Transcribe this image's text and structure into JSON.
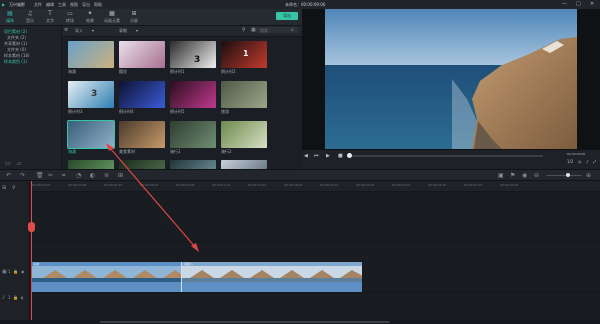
{
  "window": {
    "app_name": "万兴喵影",
    "menus": [
      "文件",
      "编辑",
      "工具",
      "视图",
      "导出",
      "帮助"
    ],
    "project_title": "未命名：00:00:09:06",
    "controls": [
      "—",
      "□",
      "✕"
    ]
  },
  "toolbar": {
    "tabs": [
      {
        "icon": "▤",
        "label": "媒体"
      },
      {
        "icon": "♫",
        "label": "音乐"
      },
      {
        "icon": "T",
        "label": "文字"
      },
      {
        "icon": "▭",
        "label": "转场"
      },
      {
        "icon": "✦",
        "label": "效果"
      },
      {
        "icon": "▦",
        "label": "动画元素"
      },
      {
        "icon": "⊞",
        "label": "分屏"
      }
    ],
    "export_label": "导出"
  },
  "sidebar": {
    "items": [
      {
        "label": "项目素材 (2)",
        "active": true
      },
      {
        "label": "文件夹 (2)",
        "active": false
      },
      {
        "label": "共享素材 (1)",
        "active": false
      },
      {
        "label": "文件夹 (0)",
        "active": false
      },
      {
        "label": "样本素材 (18)",
        "active": false
      },
      {
        "label": "样本颜色 (1)",
        "active": true
      }
    ],
    "bottom_icons": [
      "folder-icon",
      "folder-open-icon"
    ]
  },
  "library": {
    "import_label": "导入",
    "record_label": "录制",
    "search_placeholder": "搜索",
    "items": [
      {
        "label": "海滩",
        "color": "#6aa0c8",
        "color2": "#c9b27e"
      },
      {
        "label": "樱花",
        "color": "#e9e0ec",
        "color2": "#a7708f"
      },
      {
        "label": "倒计时1",
        "color": "#2a2a2a",
        "color2": "#efefef"
      },
      {
        "label": "倒计时2",
        "color": "#1a0e0e",
        "color2": "#c23a2e"
      },
      {
        "label": "倒计时3",
        "color": "#e8eef2",
        "color2": "#2d7fb3"
      },
      {
        "label": "倒计时4",
        "color": "#0d1230",
        "color2": "#3c5bd9"
      },
      {
        "label": "倒计时5",
        "color": "#2b0d1e",
        "color2": "#c03a8e"
      },
      {
        "label": "旅游",
        "color": "#4d5a47",
        "color2": "#9ca68a"
      },
      {
        "label": "海滩",
        "color": "#3a5e7a",
        "color2": "#8fb2c9"
      },
      {
        "label": "美食素材",
        "color": "#4c3b2c",
        "color2": "#c69a6a"
      },
      {
        "label": "骑行1",
        "color": "#2f3d2f",
        "color2": "#6f8e75"
      },
      {
        "label": "骑行2",
        "color": "#6c8a4c",
        "color2": "#d7dfc4"
      },
      {
        "label": "",
        "color": "#2a4a2a",
        "color2": "#6fa86f"
      },
      {
        "label": "",
        "color": "#1c2a1c",
        "color2": "#577a57"
      },
      {
        "label": "",
        "color": "#23343a",
        "color2": "#78a0a8"
      },
      {
        "label": "",
        "color": "#c7d0d8",
        "color2": "#506070"
      }
    ]
  },
  "player": {
    "timecode": "00:00:00:00",
    "scale": "1/2"
  },
  "timeline": {
    "ruler": [
      "00:00:00:00",
      "00:00:02:08",
      "00:00:04:16",
      "00:00:06:24",
      "00:00:09:06",
      "00:00:11:14",
      "00:00:13:22",
      "00:00:16:04",
      "00:00:18:12",
      "00:00:20:20",
      "00:00:23:02",
      "00:00:25:10",
      "00:00:27:18",
      "00:00:30:00"
    ],
    "clip1_name": "海滩",
    "clip2_name": "海滩 1",
    "video_track": "1",
    "audio_track": "1"
  },
  "colors": {
    "accent": "#36c5a8",
    "clip": "#4a7fb8",
    "playhead": "#e34b4b",
    "annotation": "#e04545"
  }
}
